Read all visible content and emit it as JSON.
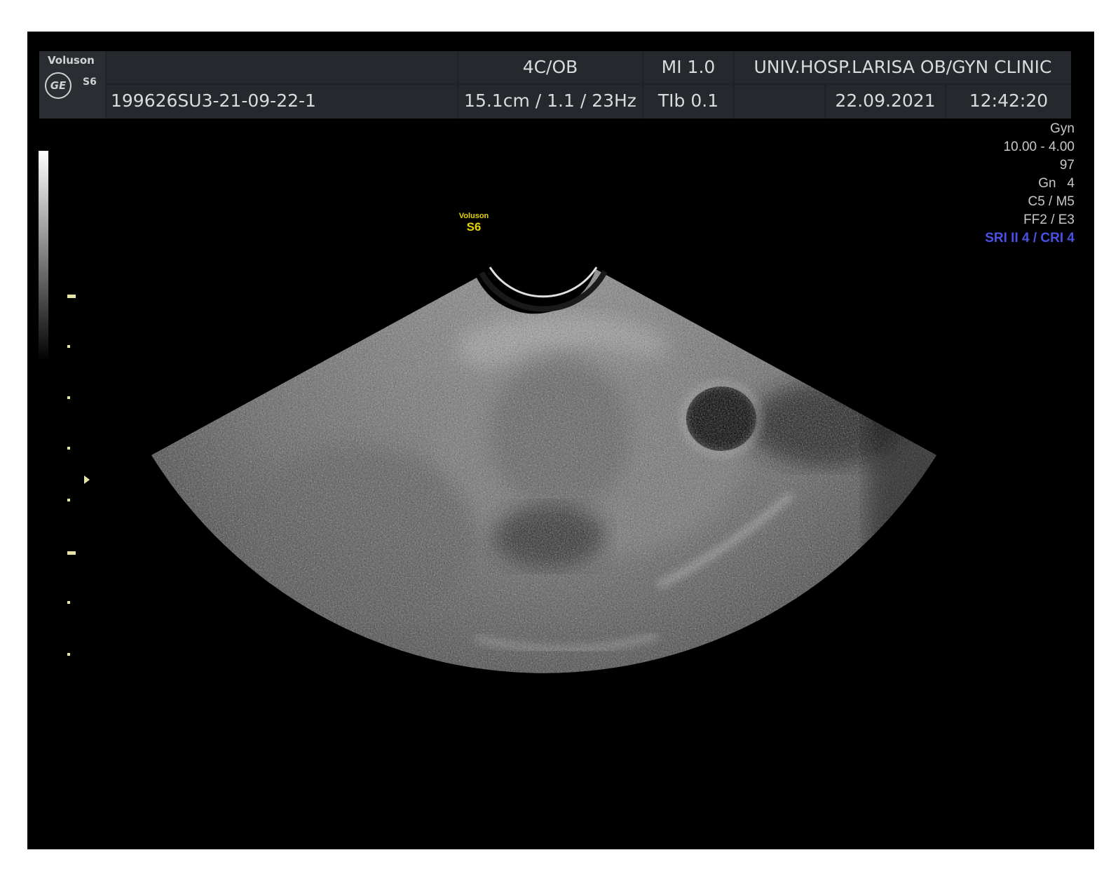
{
  "header": {
    "brand": "Voluson",
    "model": "S6",
    "logo_glyph": "GE",
    "patient_id": "199626SU3-21-09-22-1",
    "probe_preset": "4C/OB",
    "depth_params": "15.1cm / 1.1 / 23Hz",
    "mi": "MI  1.0",
    "tib": "TIb  0.1",
    "institution": "UNIV.HOSP.LARISA OB/GYN CLINIC",
    "date": "22.09.2021",
    "time": "12:42:20"
  },
  "image_params": {
    "application": "Gyn",
    "frequency": "10.00 - 4.00",
    "power": "97",
    "gain": "Gn   4",
    "contrast_map": "C5 / M5",
    "filters": "FF2 / E3",
    "processing": "SRI II 4 / CRI 4"
  },
  "probe_label": {
    "brand": "Voluson",
    "model": "S6"
  },
  "colors": {
    "screen_background": "#000000",
    "header_background": "#25282c",
    "header_text": "#d9dadc",
    "processing_text": "#4a52e6",
    "probe_label": "#e6d400",
    "depth_markers": "#e8e4a8"
  },
  "icons": {
    "logo": "ge-logo-icon",
    "focus": "focus-marker-icon"
  }
}
